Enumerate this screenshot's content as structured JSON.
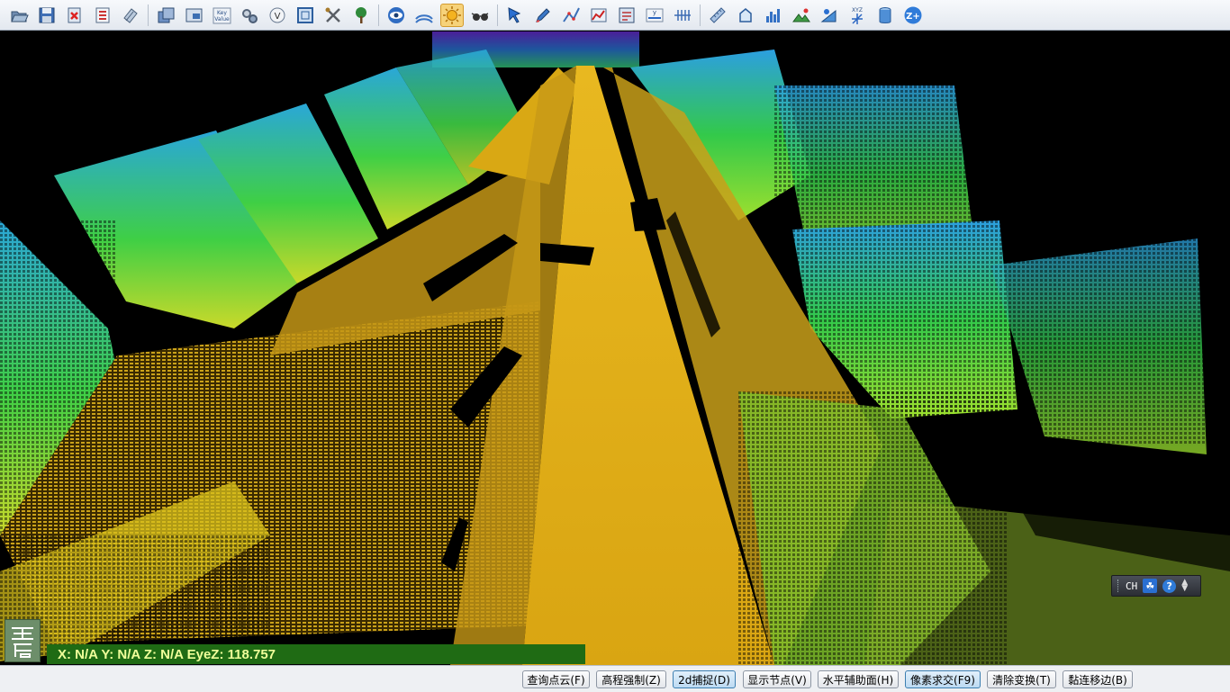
{
  "toolbar": {
    "tools": [
      {
        "name": "open-icon",
        "active": false
      },
      {
        "name": "save-icon",
        "active": false
      },
      {
        "name": "delete-file-icon",
        "active": false
      },
      {
        "name": "layer-list-icon",
        "active": false
      },
      {
        "name": "import-icon",
        "active": false
      },
      {
        "name": "window-layers-icon",
        "active": false
      },
      {
        "name": "screenshot-icon",
        "active": false
      },
      {
        "name": "key-value-icon",
        "label": "Key Value",
        "active": false
      },
      {
        "name": "settings-gears-icon",
        "active": false
      },
      {
        "name": "v-circle-icon",
        "label": "V",
        "active": false
      },
      {
        "name": "select-box-icon",
        "active": false
      },
      {
        "name": "tools-icon",
        "active": false
      },
      {
        "name": "tree-icon",
        "active": false
      },
      {
        "name": "eye-icon",
        "active": false
      },
      {
        "name": "point-cloud-icon",
        "active": false
      },
      {
        "name": "sun-icon",
        "active": true
      },
      {
        "name": "glasses-icon",
        "active": false
      },
      {
        "name": "pointer-arrow-icon",
        "active": false
      },
      {
        "name": "edit-pen-icon",
        "active": false
      },
      {
        "name": "polyline-icon",
        "active": false
      },
      {
        "name": "profile-chart-icon",
        "active": false
      },
      {
        "name": "crop-section-icon",
        "active": false
      },
      {
        "name": "y-axis-icon",
        "label": "y",
        "active": false
      },
      {
        "name": "grid-lines-icon",
        "active": false
      },
      {
        "name": "measure-ruler-icon",
        "active": false
      },
      {
        "name": "shape-icon",
        "active": false
      },
      {
        "name": "histogram-icon",
        "active": false
      },
      {
        "name": "terrain-icon",
        "active": false
      },
      {
        "name": "slope-icon",
        "active": false
      },
      {
        "name": "xyz-axes-icon",
        "label": "XYZ",
        "active": false
      },
      {
        "name": "cylinder-icon",
        "active": false
      },
      {
        "name": "zoom-z-icon",
        "label": "Z+",
        "active": false
      }
    ]
  },
  "status": {
    "coords": "X: N/A Y: N/A Z: N/A EyeZ: 118.757",
    "logo_text": "正 后"
  },
  "ime": {
    "lang": "CH",
    "help": "?"
  },
  "bottom_buttons": [
    {
      "label": "查询点云(F)",
      "on": false
    },
    {
      "label": "高程强制(Z)",
      "on": false
    },
    {
      "label": "2d捕捉(D)",
      "on": true
    },
    {
      "label": "显示节点(V)",
      "on": false
    },
    {
      "label": "水平辅助面(H)",
      "on": false
    },
    {
      "label": "像素求交(F9)",
      "on": true
    },
    {
      "label": "清除变换(T)",
      "on": false
    },
    {
      "label": "黏连移边(B)",
      "on": false
    }
  ]
}
